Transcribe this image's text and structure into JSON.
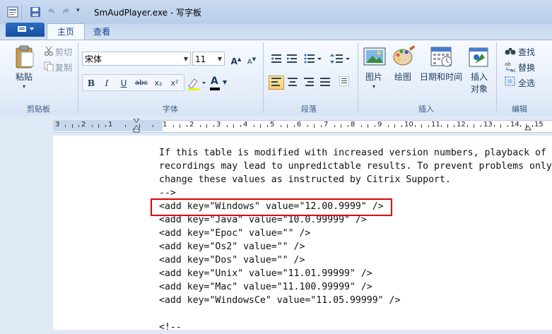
{
  "window": {
    "title": "SmAudPlayer.exe - 写字板"
  },
  "ribbon": {
    "tabs": [
      {
        "label": "主页",
        "active": true
      },
      {
        "label": "查看",
        "active": false
      }
    ],
    "clipboard": {
      "paste": "粘贴",
      "cut": "剪切",
      "copy": "复制",
      "group": "剪贴板"
    },
    "font": {
      "family": "宋体",
      "size": "11",
      "group": "字体",
      "bold": "B",
      "italic": "I",
      "underline": "U",
      "strike": "abc",
      "subscript": "x₂",
      "superscript": "x²",
      "color_letter": "A"
    },
    "paragraph": {
      "group": "段落"
    },
    "insert": {
      "picture": "图片",
      "paint": "绘图",
      "datetime": "日期和时间",
      "object_line1": "插入",
      "object_line2": "对象",
      "group": "插入"
    },
    "editing": {
      "find": "查找",
      "replace": "替换",
      "select_all": "全选",
      "group": "编辑"
    }
  },
  "ruler": {
    "labels": [
      "3",
      "2",
      "1",
      "1",
      "2",
      "3",
      "4",
      "5",
      "6",
      "7",
      "8",
      "9",
      "10",
      "11",
      "12",
      "13",
      "14",
      "15"
    ]
  },
  "document": {
    "lines": [
      "If this table is modified with increased version numbers, playback of",
      "recordings may lead to unpredictable results. To prevent problems only",
      "change these values as instructed by Citrix Support.",
      "-->",
      "<add key=\"Windows\" value=\"12.00.9999\" />",
      "<add key=\"Java\" value=\"10.0.99999\" />",
      "<add key=\"Epoc\" value=\"\" />",
      "<add key=\"Os2\" value=\"\" />",
      "<add key=\"Dos\" value=\"\" />",
      "<add key=\"Unix\" value=\"11.01.99999\" />",
      "<add key=\"Mac\" value=\"11.100.99999\" />",
      "<add key=\"WindowsCe\" value=\"11.05.99999\" />",
      "",
      "<!--"
    ]
  },
  "colors": {
    "highlight": "#e00000",
    "accent": "#2b6dc3"
  }
}
